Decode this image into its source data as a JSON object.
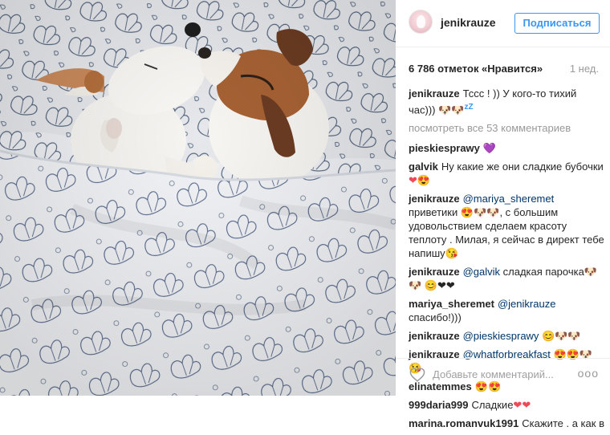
{
  "post": {
    "author": "jenikrauze",
    "follow_label": "Подписаться",
    "likes": "6 786 отметок «Нравится»",
    "time": "1 нед.",
    "caption": {
      "user": "jenikrauze",
      "text": "Тссс ! )) У кого-то тихий час)))"
    },
    "view_all": "посмотреть все 53 комментариев",
    "comments": [
      {
        "user": "pieskiesprawy",
        "text": "",
        "emoji": "💜"
      },
      {
        "user": "galvik",
        "text": "Ну какие же они сладкие бубочки",
        "emoji": "❤😍"
      },
      {
        "user": "jenikrauze",
        "mention": "@mariya_sheremet",
        "text": "приветики",
        "text2": ", с большим удовольствием сделаем красоту теплоту . Милая, я сейчас в директ тебе напишу"
      },
      {
        "user": "jenikrauze",
        "mention": "@galvik",
        "text": "сладкая парочка"
      },
      {
        "user": "mariya_sheremet",
        "mention": "@jenikrauze",
        "text": "спасибо!)))"
      },
      {
        "user": "jenikrauze",
        "mention": "@pieskiesprawy",
        "text": ""
      },
      {
        "user": "jenikrauze",
        "mention": "@whatforbreakfast",
        "text": ""
      },
      {
        "user": "elinatemmes",
        "text": ""
      },
      {
        "user": "999daria999",
        "text": "Сладкие"
      },
      {
        "user": "marina.romanvuk1991",
        "text": "Скажите . а как вы"
      }
    ],
    "add_comment_placeholder": "Добавьте комментарий...",
    "more_label": "ooo"
  },
  "icons": {
    "heart": "heart-outline-icon",
    "more": "more-options-icon"
  },
  "colors": {
    "accent": "#3897f0",
    "mention": "#003569",
    "muted": "#999999"
  }
}
